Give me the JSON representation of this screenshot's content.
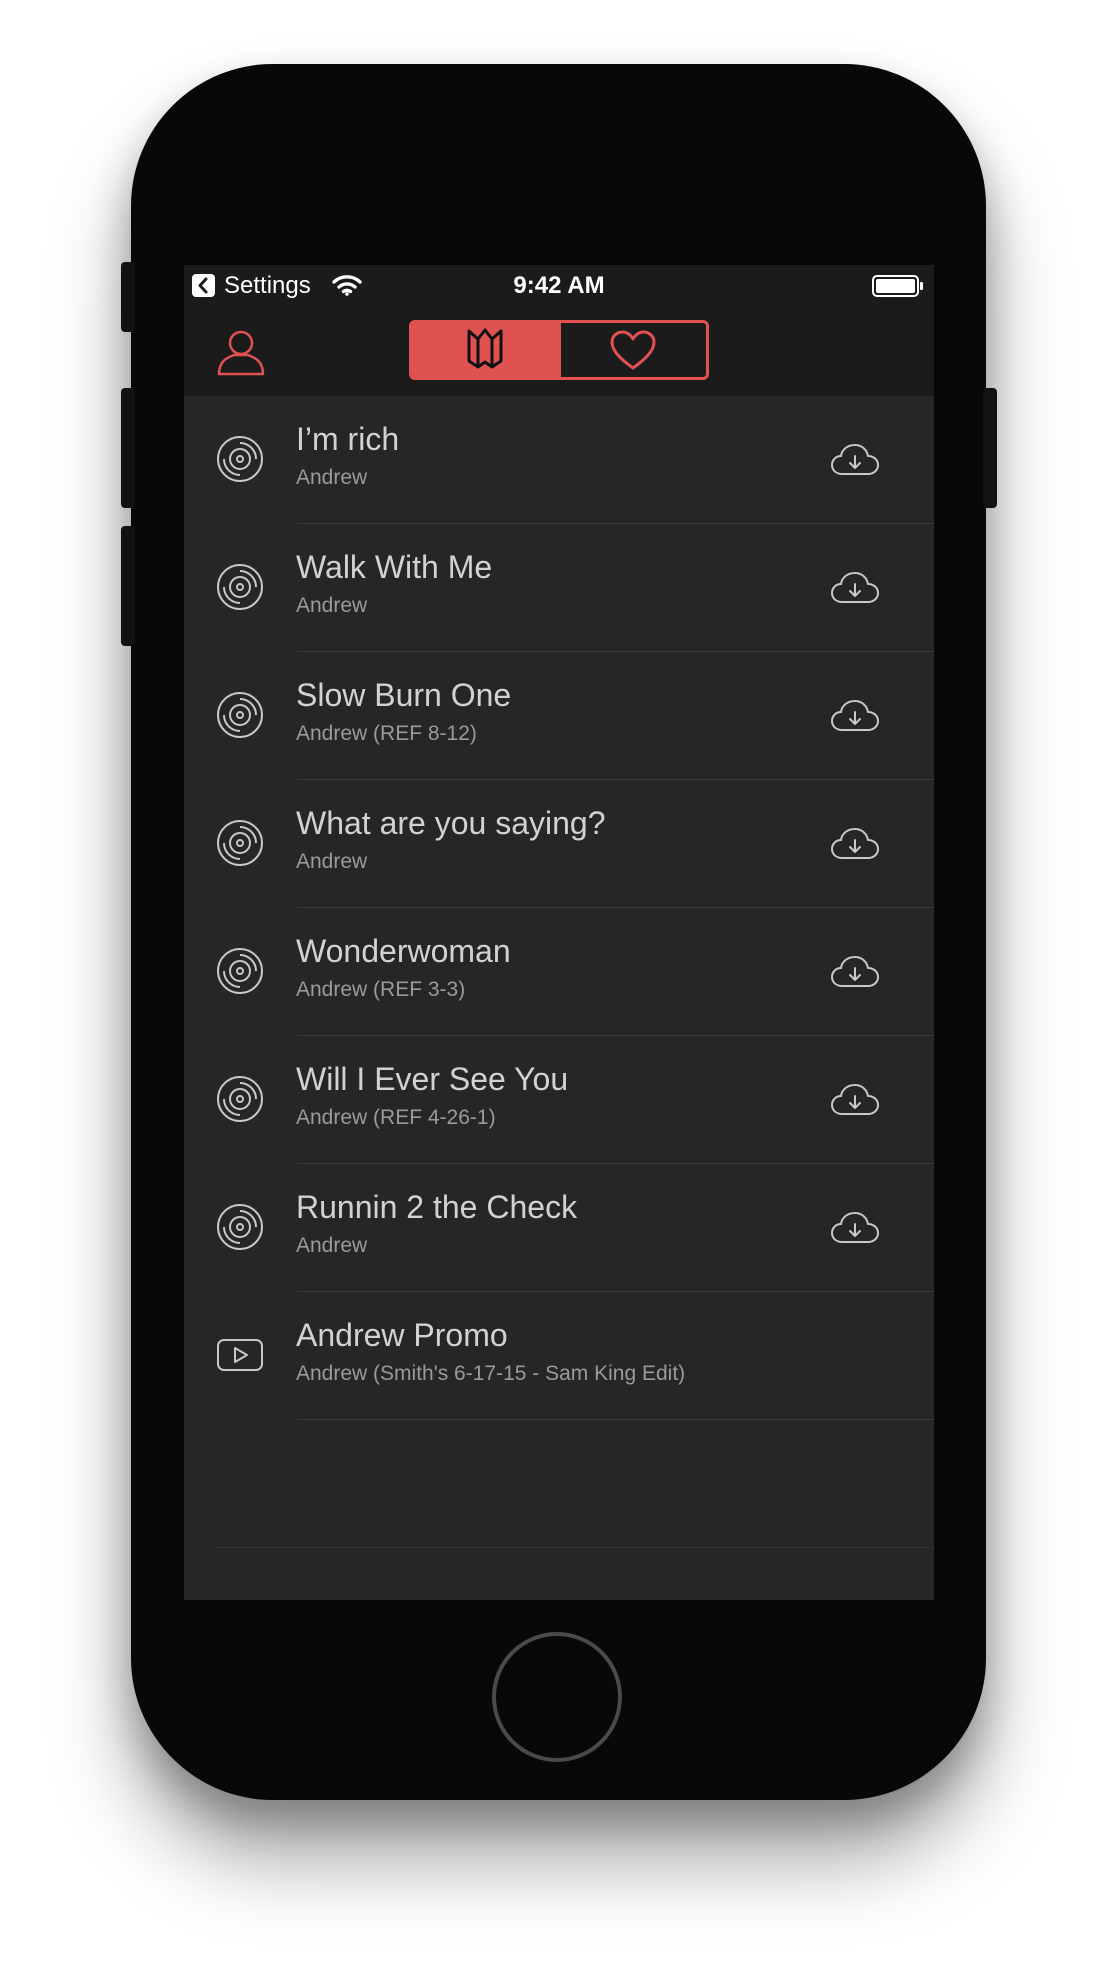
{
  "status_bar": {
    "back_label": "Settings",
    "time": "9:42 AM"
  },
  "nav": {
    "profile_icon": "person-icon",
    "segments": [
      {
        "icon": "bookmark-crown-icon",
        "selected": true
      },
      {
        "icon": "heart-icon",
        "selected": false
      }
    ]
  },
  "tracks": [
    {
      "title": "I’m rich",
      "subtitle": "Andrew",
      "type": "audio",
      "download": true
    },
    {
      "title": "Walk With Me",
      "subtitle": "Andrew",
      "type": "audio",
      "download": true
    },
    {
      "title": "Slow Burn One",
      "subtitle": "Andrew (REF 8-12)",
      "type": "audio",
      "download": true
    },
    {
      "title": "What are you saying?",
      "subtitle": "Andrew",
      "type": "audio",
      "download": true
    },
    {
      "title": "Wonderwoman",
      "subtitle": "Andrew (REF 3-3)",
      "type": "audio",
      "download": true
    },
    {
      "title": "Will I Ever See You",
      "subtitle": "Andrew (REF 4-26-1)",
      "type": "audio",
      "download": true
    },
    {
      "title": "Runnin 2 the Check",
      "subtitle": "Andrew",
      "type": "audio",
      "download": true
    },
    {
      "title": "Andrew Promo",
      "subtitle": "Andrew (Smith's 6-17-15 - Sam King Edit)",
      "type": "video",
      "download": false
    }
  ],
  "colors": {
    "accent": "#e05252",
    "background": "#262626",
    "bar": "#1b1b1b",
    "title_text": "#d2d2d2",
    "subtitle_text": "#9a9a9a"
  }
}
